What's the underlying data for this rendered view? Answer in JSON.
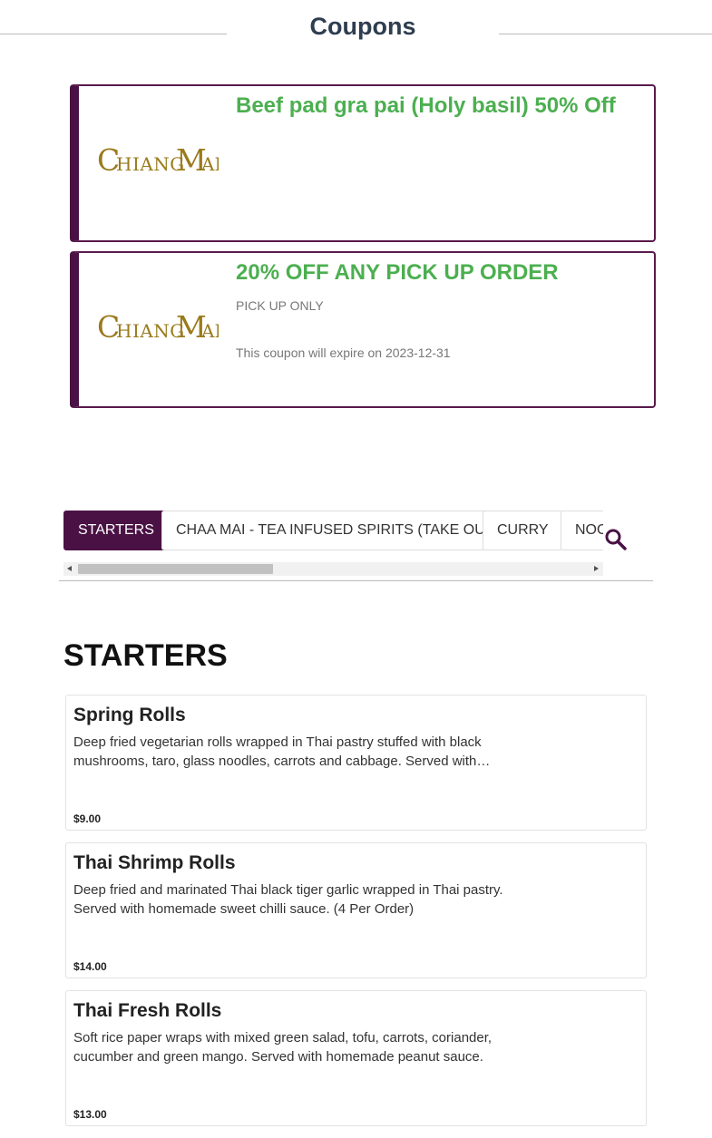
{
  "coupons_section": {
    "title": "Coupons",
    "coupons": [
      {
        "title": "Beef pad gra pai (Holy basil) 50% Off",
        "logo_text": "CHIANG MAI"
      },
      {
        "title": "20% OFF ANY PICK UP ORDER",
        "description": "PICK UP ONLY",
        "expiry": "This coupon will expire on 2023-12-31",
        "logo_text": "CHIANG MAI"
      }
    ]
  },
  "category_tabs": {
    "items": [
      {
        "label": "STARTERS",
        "active": true
      },
      {
        "label": "CHAA MAI - TEA INFUSED SPIRITS (TAKE OUT)",
        "active": false
      },
      {
        "label": "CURRY",
        "active": false
      },
      {
        "label": "NOODLES",
        "active": false
      }
    ],
    "search_icon": "search-icon"
  },
  "menu_section": {
    "title": "STARTERS",
    "items": [
      {
        "name": "Spring Rolls",
        "description": "Deep fried vegetarian rolls wrapped in Thai pastry stuffed with black mushrooms, taro, glass noodles, carrots and cabbage. Served with homemade sweet chilli sauce.",
        "price": "$9.00"
      },
      {
        "name": "Thai Shrimp Rolls",
        "description": "Deep fried and marinated Thai black tiger garlic wrapped in Thai pastry. Served with homemade sweet chilli sauce.   (4 Per Order)",
        "price": "$14.00"
      },
      {
        "name": "Thai Fresh Rolls",
        "description": "Soft rice paper wraps with mixed green salad, tofu, carrots, coriander, cucumber and green  mango. Served with homemade peanut sauce.",
        "price": "$13.00"
      }
    ]
  },
  "colors": {
    "brand_purple": "#4a1244",
    "coupon_green": "#4caf50",
    "logo_gold": "#9a7a1c"
  }
}
